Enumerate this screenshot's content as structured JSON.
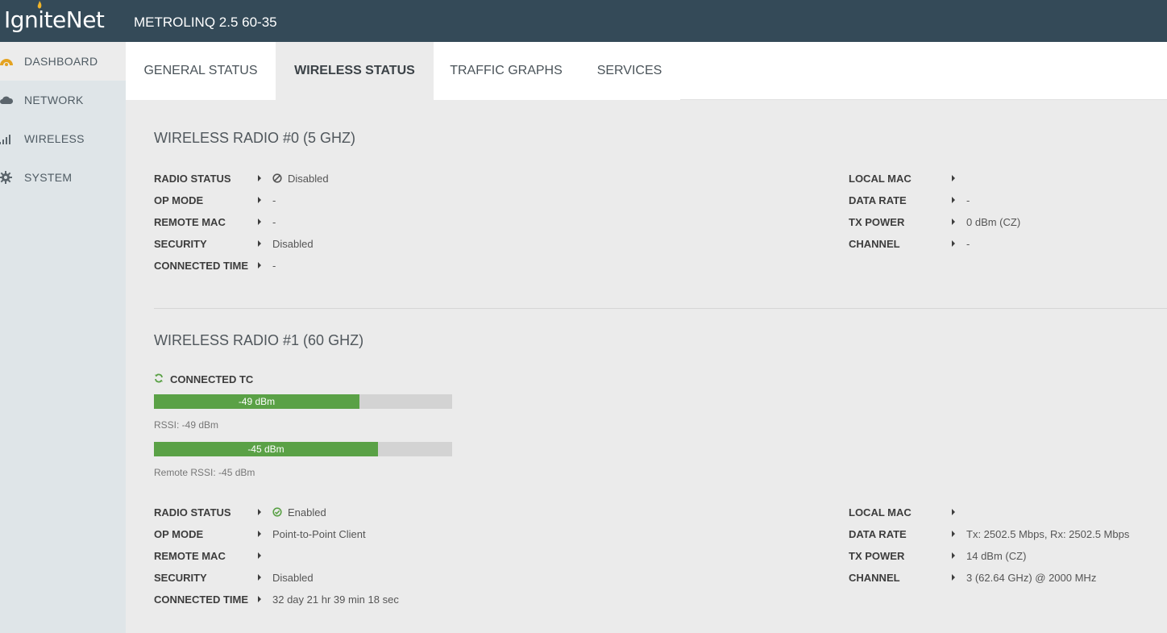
{
  "header": {
    "logo": "IgniteNet",
    "device": "METROLINQ 2.5 60-35"
  },
  "sidebar": {
    "items": [
      {
        "label": "DASHBOARD",
        "icon": "dashboard-icon"
      },
      {
        "label": "NETWORK",
        "icon": "cloud-icon"
      },
      {
        "label": "WIRELESS",
        "icon": "signal-bars-icon"
      },
      {
        "label": "SYSTEM",
        "icon": "gear-icon"
      }
    ]
  },
  "tabs": [
    {
      "label": "GENERAL STATUS"
    },
    {
      "label": "WIRELESS STATUS"
    },
    {
      "label": "TRAFFIC GRAPHS"
    },
    {
      "label": "SERVICES"
    }
  ],
  "radio0": {
    "title": "WIRELESS RADIO #0 (5 GHZ)",
    "left": [
      {
        "label": "RADIO STATUS",
        "value": "Disabled"
      },
      {
        "label": "OP MODE",
        "value": "-"
      },
      {
        "label": "REMOTE MAC",
        "value": "-"
      },
      {
        "label": "SECURITY",
        "value": "Disabled"
      },
      {
        "label": "CONNECTED TIME",
        "value": "-"
      }
    ],
    "right": [
      {
        "label": "LOCAL MAC",
        "value": ""
      },
      {
        "label": "DATA RATE",
        "value": "-"
      },
      {
        "label": "TX POWER",
        "value": "0 dBm (CZ)"
      },
      {
        "label": "CHANNEL",
        "value": "-"
      }
    ]
  },
  "radio1": {
    "title": "WIRELESS RADIO #1 (60 GHZ)",
    "connected_label": "CONNECTED TC",
    "rssi_bar": {
      "text": "-49 dBm",
      "fill_fraction": 0.69,
      "caption": "RSSI: -49 dBm"
    },
    "remote_rssi_bar": {
      "text": "-45 dBm",
      "fill_fraction": 0.752,
      "caption": "Remote RSSI: -45 dBm"
    },
    "left": [
      {
        "label": "RADIO STATUS",
        "value": "Enabled"
      },
      {
        "label": "OP MODE",
        "value": "Point-to-Point Client"
      },
      {
        "label": "REMOTE MAC",
        "value": ""
      },
      {
        "label": "SECURITY",
        "value": "Disabled"
      },
      {
        "label": "CONNECTED TIME",
        "value": "32 day 21 hr 39 min 18 sec"
      }
    ],
    "right": [
      {
        "label": "LOCAL MAC",
        "value": ""
      },
      {
        "label": "DATA RATE",
        "value": "Tx: 2502.5 Mbps, Rx: 2502.5 Mbps"
      },
      {
        "label": "TX POWER",
        "value": "14 dBm (CZ)"
      },
      {
        "label": "CHANNEL",
        "value": "3 (62.64 GHz) @ 2000 MHz"
      }
    ]
  },
  "colors": {
    "header_bg": "#344a58",
    "sidebar_bg": "#dfe5e8",
    "bar_fill": "#5aa146",
    "bar_track": "#d3d3d3",
    "accent_logo": "#f0b429",
    "enabled_green": "#5aa146"
  }
}
